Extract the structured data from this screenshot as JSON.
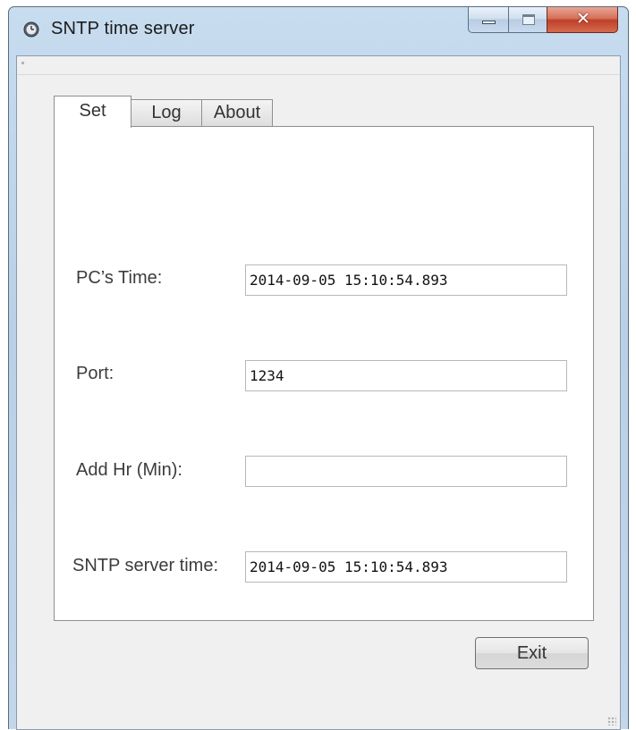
{
  "window": {
    "title": "SNTP time server"
  },
  "tabs": [
    {
      "label": "Set",
      "active": true
    },
    {
      "label": "Log",
      "active": false
    },
    {
      "label": "About",
      "active": false
    }
  ],
  "set_tab": {
    "pc_time": {
      "label": "PC’s Time:",
      "value": "2014-09-05 15:10:54.893"
    },
    "port": {
      "label": "Port:",
      "value": "1234"
    },
    "add_hr": {
      "label": "Add Hr (Min):",
      "value": ""
    },
    "sntp_time": {
      "label": "SNTP server time:",
      "value": "2014-09-05 15:10:54.893"
    }
  },
  "buttons": {
    "exit_label": "Exit"
  },
  "icons": {
    "app": "clock-icon",
    "minimize": "minimize-icon",
    "maximize": "maximize-icon",
    "close": "close-icon"
  },
  "colors": {
    "titlebar": "#c3d6ea",
    "close_button": "#c7432d",
    "client_bg": "#f0f0f0"
  }
}
